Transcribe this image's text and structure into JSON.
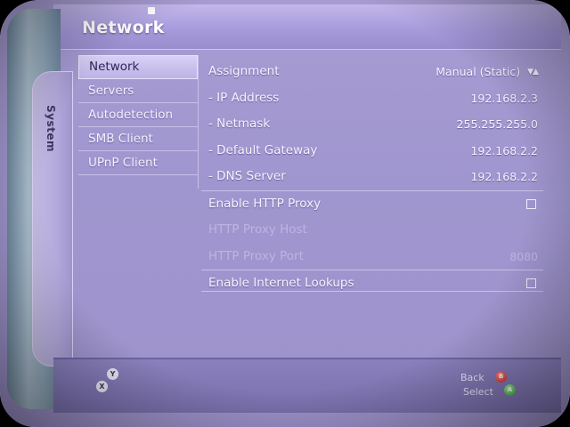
{
  "header": {
    "title": "Network"
  },
  "sidebar": {
    "blade_label": "System"
  },
  "menu": {
    "items": [
      {
        "label": "Network"
      },
      {
        "label": "Servers"
      },
      {
        "label": "Autodetection"
      },
      {
        "label": "SMB Client"
      },
      {
        "label": "UPnP Client"
      }
    ],
    "selected_index": 0
  },
  "settings": {
    "assignment": {
      "label": "Assignment",
      "value": "Manual (Static)"
    },
    "ip_address": {
      "label": "- IP Address",
      "value": "192.168.2.3"
    },
    "netmask": {
      "label": "- Netmask",
      "value": "255.255.255.0"
    },
    "gateway": {
      "label": "- Default Gateway",
      "value": "192.168.2.2"
    },
    "dns": {
      "label": "- DNS Server",
      "value": "192.168.2.2"
    },
    "http_proxy": {
      "label": "Enable HTTP Proxy",
      "checked": false
    },
    "proxy_host": {
      "label": "HTTP Proxy Host",
      "value": ""
    },
    "proxy_port": {
      "label": "HTTP Proxy Port",
      "value": "8080"
    },
    "internet_lookups": {
      "label": "Enable Internet Lookups",
      "checked": false
    }
  },
  "footer": {
    "y_button": "Y",
    "x_button": "X",
    "back_label": "Back",
    "b_button": "B",
    "select_label": "Select",
    "a_button": "A"
  },
  "colors": {
    "screen_bg": "#a096cf",
    "menu_selected_bg": "#d8d1f4",
    "text_primary": "#f6f3ff",
    "text_disabled": "#bdb4e2",
    "button_b": "#c42424",
    "button_a": "#2f9a2f"
  }
}
